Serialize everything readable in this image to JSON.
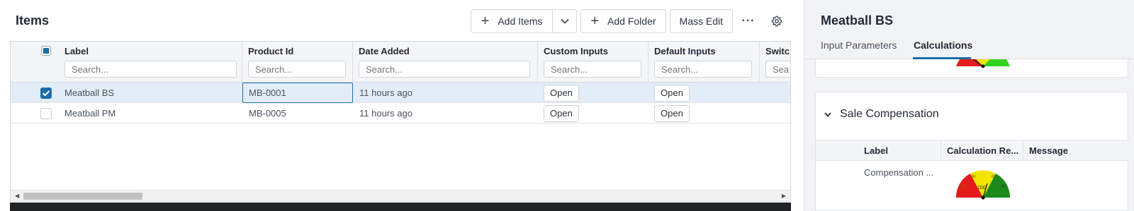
{
  "left": {
    "title": "Items",
    "toolbar": {
      "add_items_label": "Add Items",
      "add_folder_label": "Add Folder",
      "mass_edit_label": "Mass Edit"
    },
    "columns": [
      {
        "label": "Label",
        "placeholder": "Search..."
      },
      {
        "label": "Product Id",
        "placeholder": "Search..."
      },
      {
        "label": "Date Added",
        "placeholder": "Search..."
      },
      {
        "label": "Custom Inputs",
        "placeholder": "Search..."
      },
      {
        "label": "Default Inputs",
        "placeholder": "Search..."
      },
      {
        "label": "Switc",
        "placeholder": "Sea"
      }
    ],
    "rows": [
      {
        "checked": true,
        "label": "Meatball BS",
        "product_id": "MB-0001",
        "date_added": "11 hours ago",
        "custom_inputs": "Open",
        "default_inputs": "Open"
      },
      {
        "checked": false,
        "label": "Meatball PM",
        "product_id": "MB-0005",
        "date_added": "11 hours ago",
        "custom_inputs": "Open",
        "default_inputs": "Open"
      }
    ]
  },
  "right": {
    "title": "Meatball BS",
    "tabs": [
      "Input Parameters",
      "Calculations"
    ],
    "active_tab": "Calculations",
    "section": {
      "title": "Sale Compensation",
      "columns": [
        "Label",
        "Calculation Re...",
        "Message"
      ],
      "row": {
        "label": "Compensation ...",
        "gauge_center": "100",
        "gauge_ticks": [
          "20",
          "40",
          "60",
          "80"
        ]
      }
    }
  },
  "colors": {
    "accent": "#1a6fa8",
    "selected_row": "#e3edf7",
    "gauge_red": "#e31b1b",
    "gauge_yellow": "#f2e600",
    "gauge_green": "#1b8a1b"
  }
}
